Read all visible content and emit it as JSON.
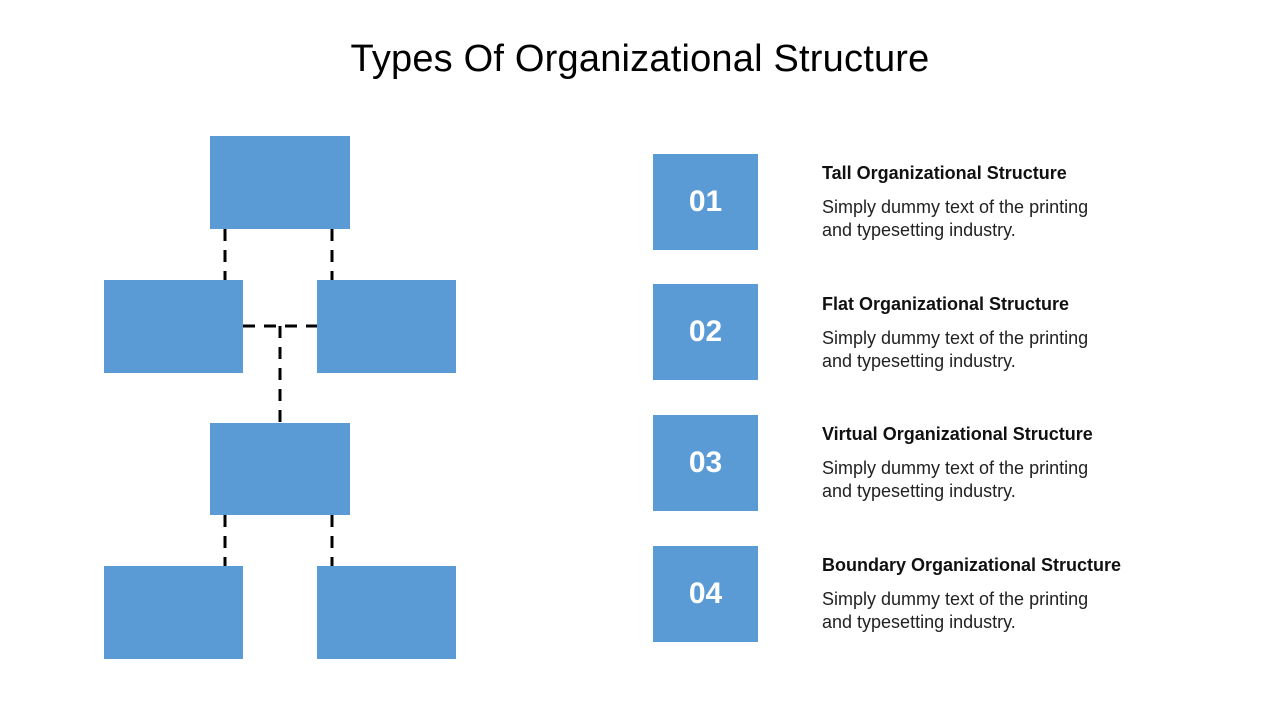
{
  "title": "Types Of Organizational Structure",
  "colors": {
    "accent": "#5b9bd5",
    "connector": "#000000",
    "text": "#000000"
  },
  "org_chart": {
    "nodes": [
      "top",
      "middle-left",
      "middle-right",
      "center",
      "bottom-left",
      "bottom-right"
    ],
    "connector_style": "dashed"
  },
  "items": [
    {
      "number": "01",
      "heading": "Tall Organizational Structure",
      "description": "Simply dummy text of the printing and typesetting industry."
    },
    {
      "number": "02",
      "heading": "Flat Organizational Structure",
      "description": "Simply dummy text of the printing and typesetting industry."
    },
    {
      "number": "03",
      "heading": "Virtual Organizational Structure",
      "description": "Simply dummy text of the printing and typesetting industry."
    },
    {
      "number": "04",
      "heading": "Boundary Organizational Structure",
      "description": "Simply dummy text of the printing and typesetting industry."
    }
  ]
}
